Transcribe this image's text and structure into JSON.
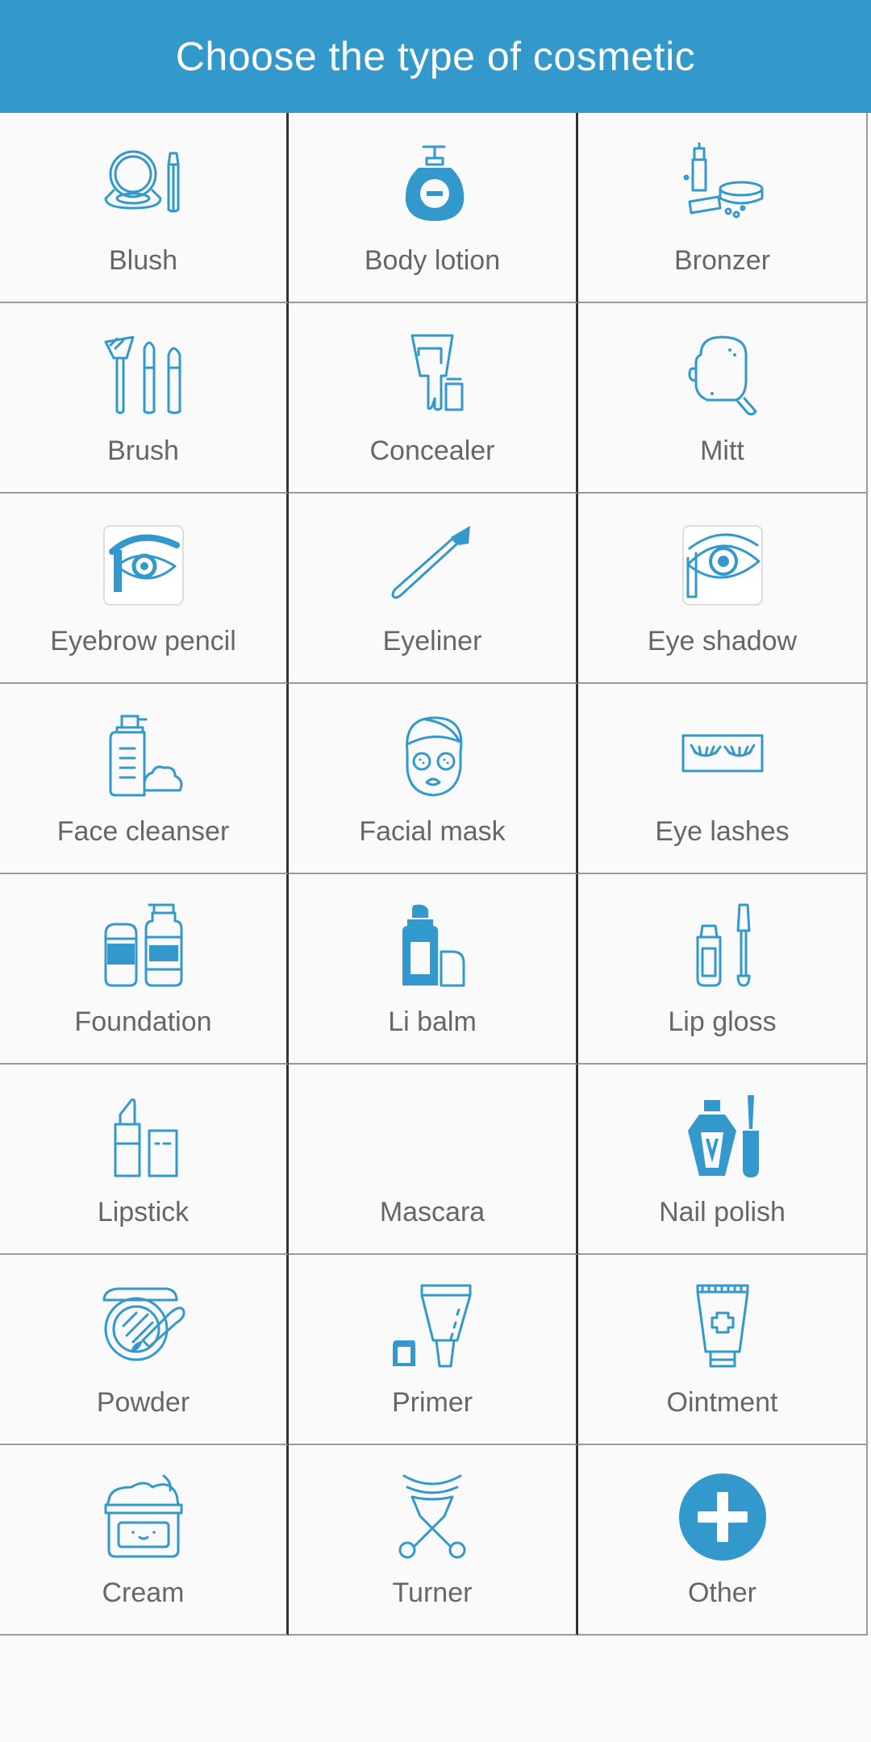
{
  "header": {
    "title": "Choose the type of cosmetic"
  },
  "accent": "#3399cc",
  "items": [
    {
      "label": "Blush",
      "icon": "blush-icon"
    },
    {
      "label": "Body lotion",
      "icon": "body-lotion-icon"
    },
    {
      "label": "Bronzer",
      "icon": "bronzer-icon"
    },
    {
      "label": "Brush",
      "icon": "brush-icon"
    },
    {
      "label": "Concealer",
      "icon": "concealer-icon"
    },
    {
      "label": "Mitt",
      "icon": "mitt-icon"
    },
    {
      "label": "Eyebrow pencil",
      "icon": "eyebrow-pencil-icon"
    },
    {
      "label": "Eyeliner",
      "icon": "eyeliner-icon"
    },
    {
      "label": "Eye shadow",
      "icon": "eye-shadow-icon"
    },
    {
      "label": "Face cleanser",
      "icon": "face-cleanser-icon"
    },
    {
      "label": "Facial mask",
      "icon": "facial-mask-icon"
    },
    {
      "label": "Eye lashes",
      "icon": "eye-lashes-icon"
    },
    {
      "label": "Foundation",
      "icon": "foundation-icon"
    },
    {
      "label": "Li balm",
      "icon": "lip-balm-icon"
    },
    {
      "label": "Lip gloss",
      "icon": "lip-gloss-icon"
    },
    {
      "label": "Lipstick",
      "icon": "lipstick-icon"
    },
    {
      "label": "Mascara",
      "icon": "mascara-icon"
    },
    {
      "label": "Nail polish",
      "icon": "nail-polish-icon"
    },
    {
      "label": "Powder",
      "icon": "powder-icon"
    },
    {
      "label": "Primer",
      "icon": "primer-icon"
    },
    {
      "label": "Ointment",
      "icon": "ointment-icon"
    },
    {
      "label": "Cream",
      "icon": "cream-icon"
    },
    {
      "label": "Turner",
      "icon": "eyelash-curler-icon"
    },
    {
      "label": "Other",
      "icon": "plus-circle-icon"
    }
  ]
}
